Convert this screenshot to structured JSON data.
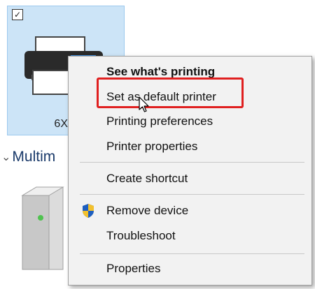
{
  "device_tile": {
    "label": "6X",
    "checked": true,
    "check_glyph": "✓"
  },
  "category": {
    "chevron_glyph": "⌄",
    "label": "Multim"
  },
  "context_menu": {
    "items": [
      {
        "label": "See what's printing",
        "bold": true
      },
      {
        "label": "Set as default printer",
        "bold": false,
        "highlighted": true
      },
      {
        "label": "Printing preferences",
        "bold": false
      },
      {
        "label": "Printer properties",
        "bold": false
      },
      {
        "label": "Create shortcut",
        "bold": false
      },
      {
        "label": "Remove device",
        "bold": false,
        "icon": "uac-shield-icon"
      },
      {
        "label": "Troubleshoot",
        "bold": false
      },
      {
        "label": "Properties",
        "bold": false
      }
    ]
  },
  "colors": {
    "highlight_border": "#e02020",
    "tile_selected": "#cce4f7",
    "menu_background": "#f2f2f2"
  }
}
